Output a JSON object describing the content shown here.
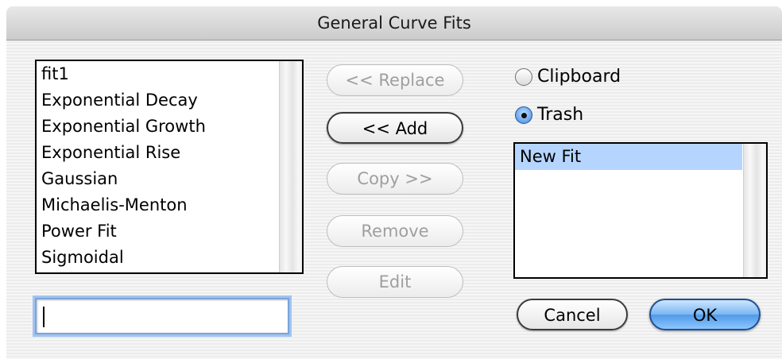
{
  "window": {
    "title": "General Curve Fits"
  },
  "left_list": {
    "items": [
      "fit1",
      "Exponential Decay",
      "Exponential Growth",
      "Exponential Rise",
      "Gaussian",
      "Michaelis-Menton",
      "Power Fit",
      "Sigmoidal"
    ]
  },
  "name_field": {
    "value": ""
  },
  "buttons": {
    "replace": "<< Replace",
    "add": "<< Add",
    "copy": "Copy >>",
    "remove": "Remove",
    "edit": "Edit",
    "cancel": "Cancel",
    "ok": "OK"
  },
  "destination": {
    "clipboard_label": "Clipboard",
    "trash_label": "Trash",
    "selected": "Trash"
  },
  "right_list": {
    "items": [
      "New Fit"
    ],
    "selected": "New Fit"
  },
  "colors": {
    "selection": "#b5d5ff",
    "default_button": "#4f99e6",
    "focus_ring": "#9fc4f0"
  }
}
